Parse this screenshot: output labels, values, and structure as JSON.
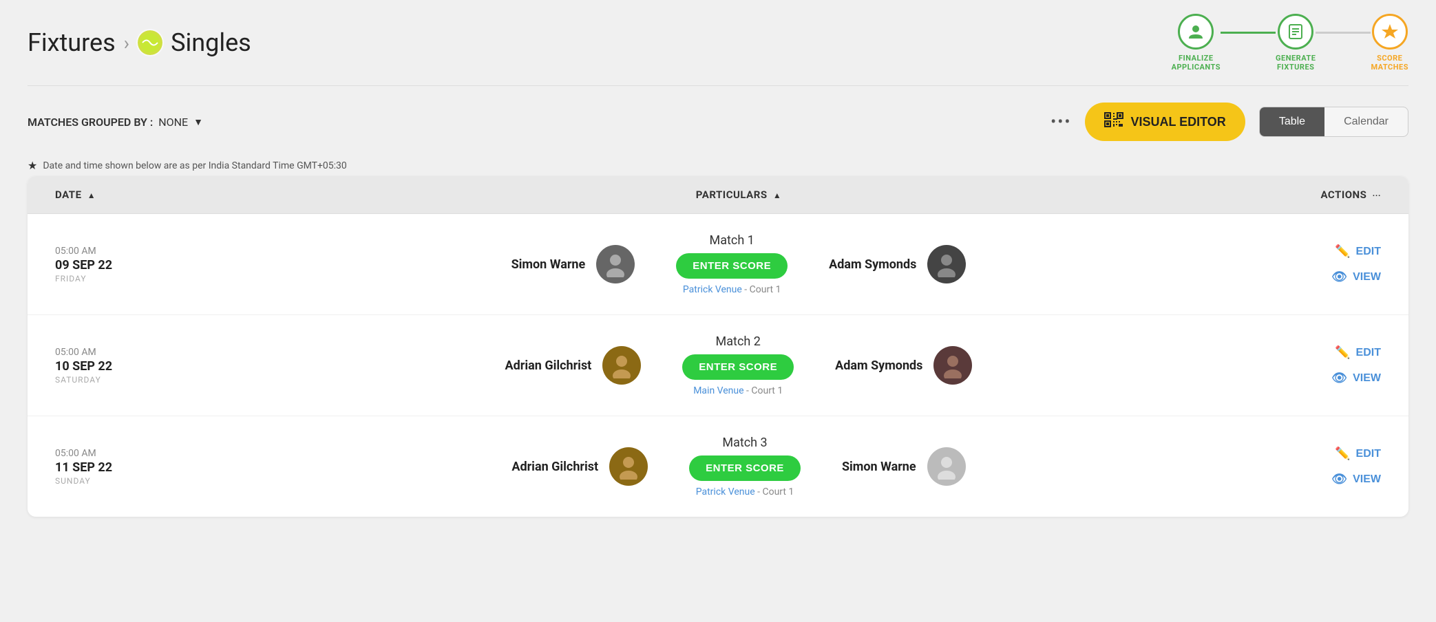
{
  "breadcrumb": {
    "parent": "Fixtures",
    "child": "Singles"
  },
  "steps": [
    {
      "label": "FINALIZE\nAPPLICANTS",
      "icon": "👤",
      "color": "green",
      "active": true
    },
    {
      "label": "GENERATE\nFIXTURES",
      "icon": "📋",
      "color": "green",
      "active": true
    },
    {
      "label": "SCORE\nMATCHES",
      "icon": "🏆",
      "color": "orange",
      "active": false
    }
  ],
  "toolbar": {
    "grouped_by_label": "MATCHES GROUPED BY :",
    "grouped_by_value": "NONE",
    "visual_editor_label": "VISUAL EDITOR",
    "view_table": "Table",
    "view_calendar": "Calendar"
  },
  "info_bar": {
    "text": "Date and time shown below are as per India Standard Time GMT+05:30"
  },
  "table": {
    "headers": {
      "date": "DATE",
      "particulars": "PARTICULARS",
      "actions": "ACTIONS"
    },
    "rows": [
      {
        "time": "05:00 AM",
        "date": "09 SEP 22",
        "day": "FRIDAY",
        "match_title": "Match 1",
        "enter_score": "ENTER SCORE",
        "venue_name": "Patrick Venue",
        "venue_court": "- Court 1",
        "player1_name": "Simon Warne",
        "player1_avatar_color": "#555",
        "player2_name": "Adam Symonds",
        "player2_avatar_color": "#333",
        "edit_label": "EDIT",
        "view_label": "VIEW"
      },
      {
        "time": "05:00 AM",
        "date": "10 SEP 22",
        "day": "SATURDAY",
        "match_title": "Match 2",
        "enter_score": "ENTER SCORE",
        "venue_name": "Main Venue",
        "venue_court": "- Court 1",
        "player1_name": "Adrian Gilchrist",
        "player1_avatar_color": "#7a5c3a",
        "player2_name": "Adam Symonds",
        "player2_avatar_color": "#333",
        "edit_label": "EDIT",
        "view_label": "VIEW"
      },
      {
        "time": "05:00 AM",
        "date": "11 SEP 22",
        "day": "SUNDAY",
        "match_title": "Match 3",
        "enter_score": "ENTER SCORE",
        "venue_name": "Patrick Venue",
        "venue_court": "- Court 1",
        "player1_name": "Adrian Gilchrist",
        "player1_avatar_color": "#7a5c3a",
        "player2_name": "Simon Warne",
        "player2_avatar_color": "#bbb",
        "edit_label": "EDIT",
        "view_label": "VIEW"
      }
    ]
  }
}
